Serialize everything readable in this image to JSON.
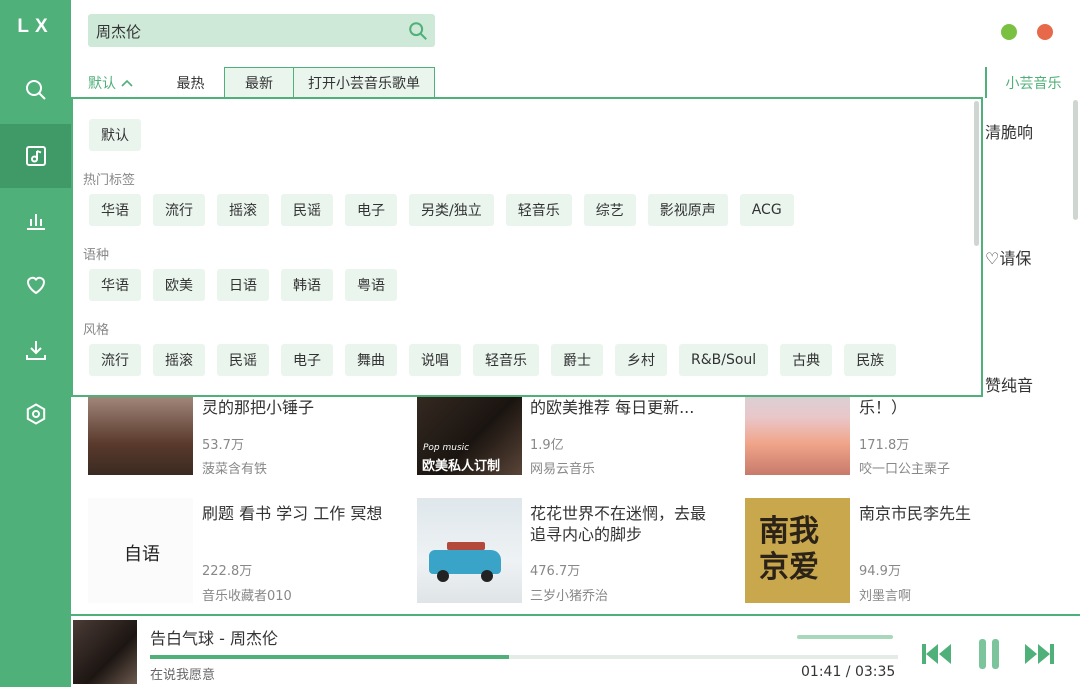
{
  "app": {
    "logo": "LX"
  },
  "sidebar": {
    "items": [
      {
        "icon": "search-icon",
        "label": "搜索"
      },
      {
        "icon": "music-list-icon",
        "label": "歌单",
        "active": true
      },
      {
        "icon": "chart-icon",
        "label": "排行榜"
      },
      {
        "icon": "heart-icon",
        "label": "我的收藏"
      },
      {
        "icon": "download-icon",
        "label": "下载"
      },
      {
        "icon": "settings-icon",
        "label": "设置"
      }
    ]
  },
  "search": {
    "value": "周杰伦"
  },
  "window": {
    "min_color": "#7ac142",
    "close_color": "#e8684a"
  },
  "sort": {
    "default_label": "默认",
    "tabs": [
      "最热",
      "最新",
      "打开小芸音乐歌单"
    ],
    "source": "小芸音乐"
  },
  "dropdown": {
    "default_tag": "默认",
    "sections": [
      {
        "label": "热门标签",
        "tags": [
          "华语",
          "流行",
          "摇滚",
          "民谣",
          "电子",
          "另类/独立",
          "轻音乐",
          "综艺",
          "影视原声",
          "ACG"
        ]
      },
      {
        "label": "语种",
        "tags": [
          "华语",
          "欧美",
          "日语",
          "韩语",
          "粤语"
        ]
      },
      {
        "label": "风格",
        "tags": [
          "流行",
          "摇滚",
          "民谣",
          "电子",
          "舞曲",
          "说唱",
          "轻音乐",
          "爵士",
          "乡村",
          "R&B/Soul",
          "古典",
          "民族"
        ]
      }
    ]
  },
  "playlists": [
    {
      "title": "灵的那把小锤子",
      "count": "53.7万",
      "author": "菠菜含有铁"
    },
    {
      "title": "的欧美推荐 每日更新...",
      "count": "1.9亿",
      "author": "网易云音乐",
      "cover_text": "Pop music",
      "cover_big": "欧美私人订制"
    },
    {
      "title": "乐！）",
      "count": "171.8万",
      "author": "咬一口公主栗子"
    },
    {
      "title": "刷题 看书 学习 工作 冥想",
      "count": "222.8万",
      "author": "音乐收藏者010",
      "cover_text": "自语"
    },
    {
      "title": "花花世界不在迷惘，去最追寻内心的脚步",
      "count": "476.7万",
      "author": "三岁小猪乔治"
    },
    {
      "title": "南京市民李先生",
      "count": "94.9万",
      "author": "刘墨言啊",
      "cover_text": "南我京爱"
    }
  ],
  "right_edge": {
    "line1": "清脆响",
    "line2": "♡请保",
    "line3": "赞纯音"
  },
  "player": {
    "title": "告白气球 - 周杰伦",
    "lyric": "在说我愿意",
    "time": "01:41 / 03:35",
    "progress": 0.48
  }
}
